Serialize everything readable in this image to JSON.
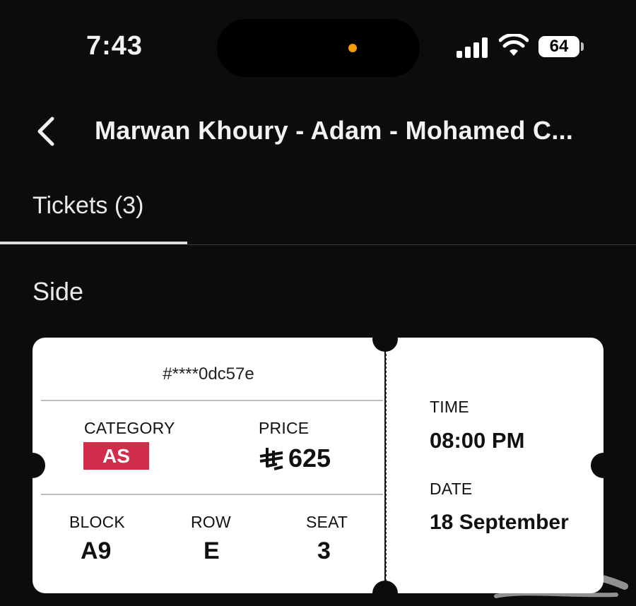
{
  "status_bar": {
    "time": "7:43",
    "battery": "64",
    "signal_icon": "cellular-signal-icon",
    "wifi_icon": "wifi-icon"
  },
  "header": {
    "title": "Marwan Khoury - Adam - Mohamed C...",
    "back_icon": "chevron-left-icon"
  },
  "tabs": [
    {
      "label": "Tickets (3)",
      "active": true
    }
  ],
  "section": {
    "label": "Side"
  },
  "ticket": {
    "id": "#****0dc57e",
    "category_label": "CATEGORY",
    "category_value": "AS",
    "category_color": "#d12c4a",
    "price_label": "PRICE",
    "price_value": "625",
    "currency_icon": "saudi-riyal-icon",
    "block_label": "BLOCK",
    "block_value": "A9",
    "row_label": "ROW",
    "row_value": "E",
    "seat_label": "SEAT",
    "seat_value": "3",
    "time_label": "TIME",
    "time_value": "08:00 PM",
    "date_label": "DATE",
    "date_value": "18 September"
  },
  "colors": {
    "background": "#0c0c0d",
    "ticket": "#ffffff",
    "accent": "#d12c4a",
    "recording_dot": "#f59a0b"
  }
}
